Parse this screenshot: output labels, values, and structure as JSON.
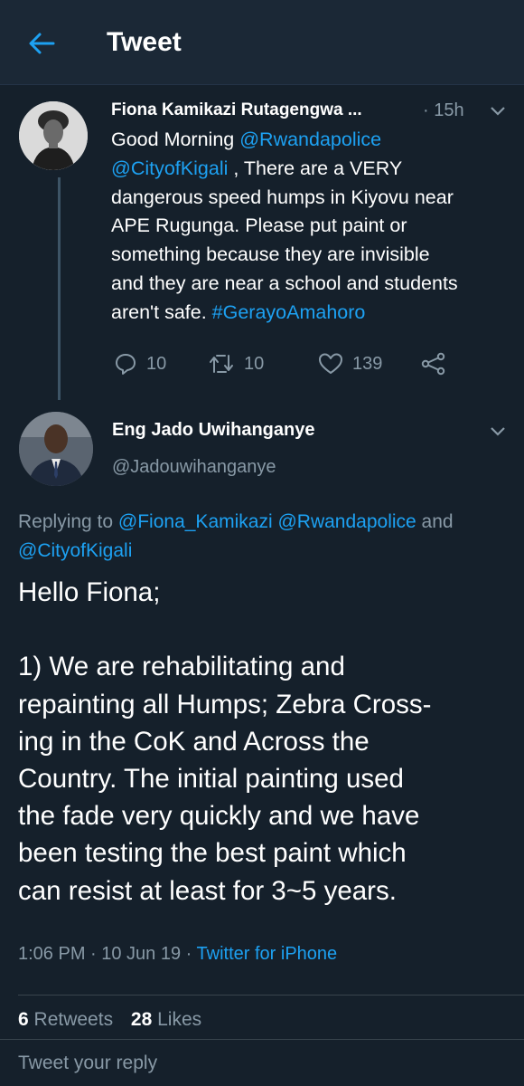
{
  "header": {
    "title": "Tweet",
    "back_icon": "arrow-left-icon"
  },
  "colors": {
    "background": "#15202b",
    "header_bg": "#1b2836",
    "link": "#1da1f2",
    "secondary_text": "#8899a6"
  },
  "original_tweet": {
    "author_name": "Fiona Kamikazi Rutagengwa ...",
    "time": "· 15h",
    "text_lines": [
      [
        {
          "t": "Good Morning "
        },
        {
          "t": "@Rwandapolice",
          "link": true
        }
      ],
      [
        {
          "t": "@CityofKigali",
          "link": true
        },
        {
          "t": " , There are a VERY"
        }
      ],
      [
        {
          "t": "dangerous speed humps in Kiyovu near"
        }
      ],
      [
        {
          "t": "APE Rugunga. Please put paint or"
        }
      ],
      [
        {
          "t": "something because they are invisible"
        }
      ],
      [
        {
          "t": "and they are near a school and students"
        }
      ],
      [
        {
          "t": "aren't safe. "
        },
        {
          "t": "#GerayoAmahoro",
          "link": true
        }
      ]
    ],
    "actions": {
      "replies": "10",
      "retweets": "10",
      "likes": "139"
    }
  },
  "reply_tweet": {
    "author_name": "Eng Jado Uwihanganye",
    "handle": "@Jadouwihanganye",
    "replying_lines": [
      [
        {
          "t": "Replying to "
        },
        {
          "t": "@Fiona_Kamikazi",
          "link": true
        },
        {
          "t": " "
        },
        {
          "t": "@Rwandapolice",
          "link": true
        },
        {
          "t": " and"
        }
      ],
      [
        {
          "t": "@CityofKigali",
          "link": true
        }
      ]
    ],
    "text_lines": [
      "Hello Fiona;",
      "",
      "1) We are rehabilitating and",
      "repainting all Humps; Zebra Cross-",
      "ing in the CoK and Across the",
      "Country. The initial painting used",
      "the fade very quickly and we have",
      "been testing the best paint which",
      "can resist at least for 3~5 years."
    ],
    "timestamp": "1:06 PM · 10 Jun 19 · ",
    "source": "Twitter for iPhone",
    "retweets_count": "6",
    "retweets_label": "Retweets",
    "likes_count": "28",
    "likes_label": "Likes"
  },
  "reply_box": {
    "placeholder": "Tweet your reply"
  }
}
